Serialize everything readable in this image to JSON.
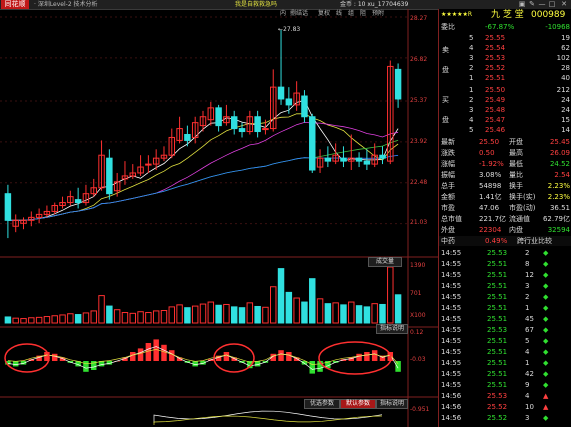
{
  "app": {
    "logo_text": "同花顺",
    "window_title": "· 深圳Level-2 技术分析",
    "ad_text": "我是自救救急吗",
    "account_text": "金币 : 10   xu_17704639",
    "controls": [
      "▣",
      "✎",
      "—",
      "□",
      "✕"
    ]
  },
  "toolbar": [
    "内",
    "捌结话",
    "复权",
    "线",
    "组",
    "阻",
    "预附"
  ],
  "kline": {
    "price_axis": [
      "28.27",
      "26.82",
      "25.37",
      "23.92",
      "22.48",
      "21.03"
    ],
    "high_label": "←27.83",
    "volume_button": "成交量",
    "volume_axis": [
      "1390",
      "701",
      "X100"
    ],
    "indicator_button": "指标说明",
    "macd_axis": [
      "0.12",
      "-0.03"
    ],
    "sub_axis": [
      "-0.951"
    ],
    "bottom_buttons": [
      "优选参数",
      "默认参数",
      "指标说明"
    ],
    "candles": [
      {
        "o": 22.3,
        "c": 21.4,
        "h": 22.6,
        "l": 20.8
      },
      {
        "o": 21.2,
        "c": 21.4,
        "h": 21.6,
        "l": 21.0
      },
      {
        "o": 21.3,
        "c": 21.4,
        "h": 21.5,
        "l": 21.1
      },
      {
        "o": 21.4,
        "c": 21.5,
        "h": 21.7,
        "l": 21.2
      },
      {
        "o": 21.5,
        "c": 21.6,
        "h": 21.8,
        "l": 21.3
      },
      {
        "o": 21.6,
        "c": 21.7,
        "h": 21.9,
        "l": 21.5
      },
      {
        "o": 21.7,
        "c": 21.9,
        "h": 22.0,
        "l": 21.6
      },
      {
        "o": 21.9,
        "c": 22.0,
        "h": 22.2,
        "l": 21.8
      },
      {
        "o": 22.0,
        "c": 22.2,
        "h": 22.4,
        "l": 21.9
      },
      {
        "o": 22.1,
        "c": 22.0,
        "h": 22.5,
        "l": 21.8
      },
      {
        "o": 22.0,
        "c": 22.3,
        "h": 22.6,
        "l": 21.9
      },
      {
        "o": 22.3,
        "c": 22.5,
        "h": 22.8,
        "l": 22.2
      },
      {
        "o": 22.5,
        "c": 23.6,
        "h": 24.1,
        "l": 22.4
      },
      {
        "o": 23.5,
        "c": 22.3,
        "h": 23.8,
        "l": 22.1
      },
      {
        "o": 22.4,
        "c": 22.7,
        "h": 23.0,
        "l": 22.2
      },
      {
        "o": 22.8,
        "c": 22.9,
        "h": 23.4,
        "l": 22.6
      },
      {
        "o": 22.9,
        "c": 23.0,
        "h": 23.3,
        "l": 22.8
      },
      {
        "o": 23.0,
        "c": 23.2,
        "h": 23.6,
        "l": 22.9
      },
      {
        "o": 23.3,
        "c": 23.3,
        "h": 23.6,
        "l": 23.0
      },
      {
        "o": 23.3,
        "c": 23.5,
        "h": 23.8,
        "l": 23.1
      },
      {
        "o": 23.5,
        "c": 23.6,
        "h": 23.9,
        "l": 23.4
      },
      {
        "o": 23.6,
        "c": 24.2,
        "h": 24.5,
        "l": 23.5
      },
      {
        "o": 24.1,
        "c": 24.5,
        "h": 24.9,
        "l": 24.0
      },
      {
        "o": 24.3,
        "c": 24.1,
        "h": 24.6,
        "l": 23.9
      },
      {
        "o": 24.2,
        "c": 24.7,
        "h": 24.9,
        "l": 24.0
      },
      {
        "o": 24.6,
        "c": 24.9,
        "h": 25.1,
        "l": 24.4
      },
      {
        "o": 24.8,
        "c": 25.2,
        "h": 25.4,
        "l": 24.6
      },
      {
        "o": 25.2,
        "c": 24.6,
        "h": 25.3,
        "l": 24.4
      },
      {
        "o": 24.7,
        "c": 24.9,
        "h": 25.3,
        "l": 24.6
      },
      {
        "o": 24.9,
        "c": 24.5,
        "h": 25.1,
        "l": 24.3
      },
      {
        "o": 24.5,
        "c": 24.4,
        "h": 24.7,
        "l": 24.2
      },
      {
        "o": 24.4,
        "c": 24.9,
        "h": 25.1,
        "l": 24.3
      },
      {
        "o": 24.9,
        "c": 24.4,
        "h": 25.1,
        "l": 24.2
      },
      {
        "o": 24.5,
        "c": 24.5,
        "h": 24.8,
        "l": 24.3
      },
      {
        "o": 24.5,
        "c": 25.9,
        "h": 26.5,
        "l": 24.4
      },
      {
        "o": 25.9,
        "c": 25.5,
        "h": 27.83,
        "l": 25.3
      },
      {
        "o": 25.5,
        "c": 25.3,
        "h": 25.9,
        "l": 25.0
      },
      {
        "o": 25.3,
        "c": 25.7,
        "h": 26.1,
        "l": 25.1
      },
      {
        "o": 25.6,
        "c": 24.9,
        "h": 25.8,
        "l": 24.7
      },
      {
        "o": 24.9,
        "c": 23.1,
        "h": 25.0,
        "l": 23.0
      },
      {
        "o": 23.2,
        "c": 23.5,
        "h": 23.8,
        "l": 23.0
      },
      {
        "o": 23.5,
        "c": 23.4,
        "h": 23.9,
        "l": 23.2
      },
      {
        "o": 23.4,
        "c": 23.6,
        "h": 24.0,
        "l": 23.3
      },
      {
        "o": 23.5,
        "c": 23.4,
        "h": 23.9,
        "l": 23.2
      },
      {
        "o": 23.4,
        "c": 23.5,
        "h": 24.3,
        "l": 23.1
      },
      {
        "o": 23.5,
        "c": 23.4,
        "h": 23.7,
        "l": 23.2
      },
      {
        "o": 23.4,
        "c": 23.3,
        "h": 23.8,
        "l": 23.1
      },
      {
        "o": 23.3,
        "c": 23.6,
        "h": 24.0,
        "l": 23.2
      },
      {
        "o": 23.6,
        "c": 23.5,
        "h": 23.9,
        "l": 23.3
      },
      {
        "o": 23.4,
        "c": 26.6,
        "h": 26.8,
        "l": 23.3
      },
      {
        "o": 26.5,
        "c": 25.5,
        "h": 26.7,
        "l": 25.2
      }
    ],
    "volumes": [
      150,
      120,
      110,
      130,
      140,
      160,
      180,
      200,
      230,
      210,
      250,
      300,
      680,
      420,
      330,
      260,
      240,
      280,
      260,
      300,
      310,
      400,
      450,
      380,
      420,
      470,
      520,
      440,
      460,
      400,
      380,
      500,
      410,
      390,
      900,
      1350,
      760,
      620,
      520,
      1100,
      600,
      480,
      500,
      450,
      520,
      430,
      400,
      480,
      460,
      1390,
      700
    ],
    "macd": [
      -0.02,
      -0.03,
      -0.02,
      0.01,
      0.03,
      0.05,
      0.04,
      0.02,
      -0.01,
      -0.03,
      -0.06,
      -0.05,
      -0.03,
      -0.02,
      0.0,
      0.02,
      0.05,
      0.07,
      0.1,
      0.12,
      0.09,
      0.06,
      0.02,
      -0.01,
      -0.03,
      -0.02,
      0.01,
      0.03,
      0.05,
      0.02,
      -0.01,
      -0.04,
      -0.03,
      -0.01,
      0.04,
      0.06,
      0.05,
      0.02,
      -0.02,
      -0.07,
      -0.06,
      -0.04,
      -0.01,
      0.01,
      0.02,
      0.04,
      0.05,
      0.06,
      0.03,
      0.05,
      -0.06
    ]
  },
  "quote": {
    "stars": "★★★★★R",
    "name": "九 芝 堂",
    "code": "000989",
    "weibi_label": "委比",
    "weibi_value": "-67.87%",
    "weicha_value": "-10968",
    "sell_label_1": "卖",
    "sell_label_2": "盘",
    "buy_label_1": "买",
    "buy_label_2": "盘",
    "sells": [
      {
        "level": "5",
        "price": "25.55",
        "vol": "19"
      },
      {
        "level": "4",
        "price": "25.54",
        "vol": "62"
      },
      {
        "level": "3",
        "price": "25.53",
        "vol": "102"
      },
      {
        "level": "2",
        "price": "25.52",
        "vol": "28"
      },
      {
        "level": "1",
        "price": "25.51",
        "vol": "40"
      }
    ],
    "buys": [
      {
        "level": "1",
        "price": "25.50",
        "vol": "212"
      },
      {
        "level": "2",
        "price": "25.49",
        "vol": "24"
      },
      {
        "level": "3",
        "price": "25.48",
        "vol": "24"
      },
      {
        "level": "4",
        "price": "25.47",
        "vol": "15"
      },
      {
        "level": "5",
        "price": "25.46",
        "vol": "14"
      }
    ],
    "stats": [
      {
        "l1": "最新",
        "v1": "25.50",
        "l2": "开盘",
        "v2": "25.45"
      },
      {
        "l1": "涨跌",
        "v1": "0.50",
        "l2": "最高",
        "v2": "26.09"
      },
      {
        "l1": "涨幅",
        "v1": "-1.92%",
        "l2": "最低",
        "v2": "24.52"
      },
      {
        "l1": "振幅",
        "v1": "3.08%",
        "l2": "量比",
        "v2": "2.54"
      },
      {
        "l1": "总手",
        "v1": "54898",
        "l2": "换手",
        "v2": "2.23%"
      },
      {
        "l1": "金额",
        "v1": "1.41亿",
        "l2": "换手(实)",
        "v2": "2.23%"
      },
      {
        "l1": "市盈",
        "v1": "47.06",
        "l2": "市盈(动)",
        "v2": "36.51"
      },
      {
        "l1": "总市值",
        "v1": "221.7亿",
        "l2": "流通值",
        "v2": "62.79亿"
      },
      {
        "l1": "外盘",
        "v1": "22304",
        "l2": "内盘",
        "v2": "32594"
      }
    ],
    "tabs": {
      "left": "中药",
      "mid": "0.49%",
      "right": "跨行业比较"
    },
    "ticks": [
      {
        "t": "14:55",
        "p": "25.53",
        "v": "2",
        "d": "down"
      },
      {
        "t": "14:55",
        "p": "25.51",
        "v": "8",
        "d": "down"
      },
      {
        "t": "14:55",
        "p": "25.51",
        "v": "12",
        "d": "down"
      },
      {
        "t": "14:55",
        "p": "25.51",
        "v": "3",
        "d": "down"
      },
      {
        "t": "14:55",
        "p": "25.51",
        "v": "2",
        "d": "down"
      },
      {
        "t": "14:55",
        "p": "25.51",
        "v": "1",
        "d": "down"
      },
      {
        "t": "14:55",
        "p": "25.51",
        "v": "45",
        "d": "down"
      },
      {
        "t": "14:55",
        "p": "25.53",
        "v": "67",
        "d": "down"
      },
      {
        "t": "14:55",
        "p": "25.51",
        "v": "5",
        "d": "down"
      },
      {
        "t": "14:55",
        "p": "25.51",
        "v": "4",
        "d": "down"
      },
      {
        "t": "14:55",
        "p": "25.51",
        "v": "1",
        "d": "down"
      },
      {
        "t": "14:55",
        "p": "25.51",
        "v": "42",
        "d": "down"
      },
      {
        "t": "14:55",
        "p": "25.51",
        "v": "9",
        "d": "down"
      },
      {
        "t": "14:56",
        "p": "25.53",
        "v": "4",
        "d": "up"
      },
      {
        "t": "14:56",
        "p": "25.52",
        "v": "10",
        "d": "up"
      },
      {
        "t": "14:56",
        "p": "25.52",
        "v": "3",
        "d": "down"
      }
    ]
  }
}
